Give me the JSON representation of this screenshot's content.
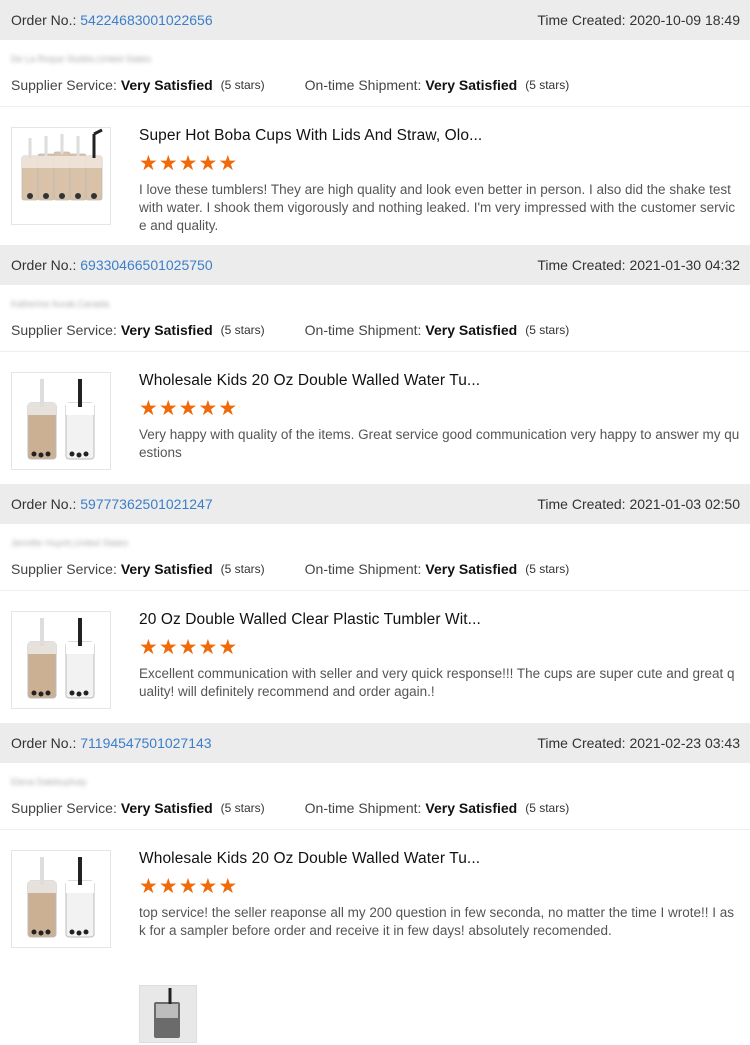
{
  "labels": {
    "order_no": "Order No.:",
    "time_created": "Time Created:",
    "supplier_service": "Supplier Service:",
    "ontime_shipment": "On-time Shipment:"
  },
  "reviews": [
    {
      "order_no": "54224683001022656",
      "time": "2020-10-09 18:49",
      "buyer": "De La Roque Stubbs,United States",
      "supplier_rating": "Very Satisfied",
      "supplier_stars": "(5 stars)",
      "shipment_rating": "Very Satisfied",
      "shipment_stars": "(5 stars)",
      "product_title": "Super Hot Boba Cups With Lids And Straw, Olo...",
      "stars": 5,
      "text": "I love these tumblers! They are high quality and look even better in person. I also did the shake test with water. I shook them vigorously and nothing leaked. I'm very impressed with the customer service and quality."
    },
    {
      "order_no": "69330466501025750",
      "time": "2021-01-30 04:32",
      "buyer": "Katherine Aurak,Canada",
      "supplier_rating": "Very Satisfied",
      "supplier_stars": "(5 stars)",
      "shipment_rating": "Very Satisfied",
      "shipment_stars": "(5 stars)",
      "product_title": "Wholesale Kids 20 Oz Double Walled Water Tu...",
      "stars": 5,
      "text": "Very happy with quality of the items. Great service good communication  very happy to answer my questions"
    },
    {
      "order_no": "59777362501021247",
      "time": "2021-01-03 02:50",
      "buyer": "Jennifer Huynh,United States",
      "supplier_rating": "Very Satisfied",
      "supplier_stars": "(5 stars)",
      "shipment_rating": "Very Satisfied",
      "shipment_stars": "(5 stars)",
      "product_title": "20 Oz Double Walled Clear Plastic Tumbler Wit...",
      "stars": 5,
      "text": "Excellent communication with seller and very quick response!!! The cups are super cute and great quality! will definitely recommend and order again.!"
    },
    {
      "order_no": "71194547501027143",
      "time": "2021-02-23 03:43",
      "buyer": "Elena Dalebuyhuty",
      "supplier_rating": "Very Satisfied",
      "supplier_stars": "(5 stars)",
      "shipment_rating": "Very Satisfied",
      "shipment_stars": "(5 stars)",
      "product_title": "Wholesale Kids 20 Oz Double Walled Water Tu...",
      "stars": 5,
      "text": "top service! the seller reaponse all my 200 question in few seconda, no matter the time I wrote!! I ask for a sampler before order and receive it in few days! absolutely recomended."
    }
  ],
  "colors": {
    "star": "#f06a0a",
    "link": "#3d7ec9",
    "bar": "#ececec"
  }
}
